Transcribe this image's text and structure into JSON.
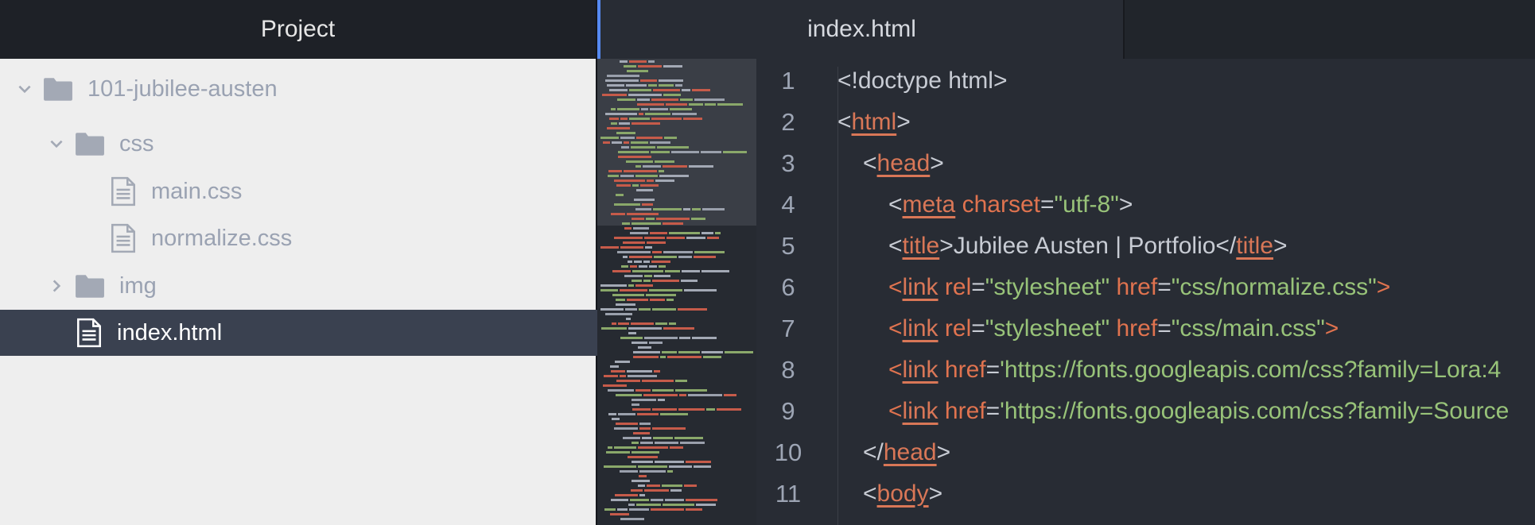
{
  "sidebar": {
    "title": "Project",
    "tree": [
      {
        "label": "101-jubilee-austen",
        "type": "folder",
        "expanded": true,
        "depth": 0
      },
      {
        "label": "css",
        "type": "folder",
        "expanded": true,
        "depth": 1
      },
      {
        "label": "main.css",
        "type": "file",
        "depth": 2
      },
      {
        "label": "normalize.css",
        "type": "file",
        "depth": 2
      },
      {
        "label": "img",
        "type": "folder",
        "expanded": false,
        "depth": 1
      },
      {
        "label": "index.html",
        "type": "file",
        "depth": 1,
        "selected": true
      }
    ]
  },
  "editor": {
    "tab_label": "index.html",
    "accent_color": "#568af2",
    "line_numbers": [
      "1",
      "2",
      "3",
      "4",
      "5",
      "6",
      "7",
      "8",
      "9",
      "10",
      "11"
    ],
    "code": {
      "l1": "<!doctype html>",
      "l2_tag": "html",
      "l3_tag": "head",
      "l4_tag": "meta",
      "l4_attr": "charset",
      "l4_val": "\"utf-8\"",
      "l5_tag": "title",
      "l5_text": "Jubilee Austen | Portfolio",
      "l6_tag": "link",
      "l6_attr1": "rel",
      "l6_val1": "\"stylesheet\"",
      "l6_attr2": "href",
      "l6_val2": "\"css/normalize.css\"",
      "l7_tag": "link",
      "l7_attr1": "rel",
      "l7_val1": "\"stylesheet\"",
      "l7_attr2": "href",
      "l7_val2": "\"css/main.css\"",
      "l8_tag": "link",
      "l8_attr": "href",
      "l8_val": "'https://fonts.googleapis.com/css?family=Lora:4",
      "l9_tag": "link",
      "l9_attr": "href",
      "l9_val": "'https://fonts.googleapis.com/css?family=Source",
      "l10_tag": "head",
      "l11_tag": "body"
    }
  }
}
